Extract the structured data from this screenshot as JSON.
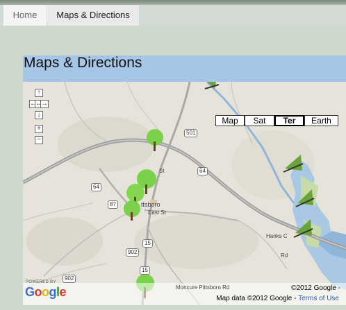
{
  "nav": {
    "home_label": "Home",
    "maps_label": "Maps & Directions"
  },
  "page": {
    "title": "Maps & Directions"
  },
  "map": {
    "controls": {
      "pan_up": "↑",
      "pan_left": "←",
      "pan_center": "↔",
      "pan_right": "→",
      "pan_down": "↓",
      "zoom_in": "+",
      "zoom_out": "−"
    },
    "map_types": [
      {
        "label": "Map",
        "active": false
      },
      {
        "label": "Sat",
        "active": false
      },
      {
        "label": "Ter",
        "active": true
      },
      {
        "label": "Earth",
        "active": false
      }
    ],
    "road_shields": [
      "501",
      "64",
      "64",
      "87",
      "64",
      "902",
      "15",
      "15",
      "902"
    ],
    "road_labels": {
      "east_st": "East St",
      "town": "ttsboro",
      "st": "St",
      "hanks": "Hanks C",
      "rd": "Rd",
      "moncure": "Moncure Pittsboro Rd"
    },
    "powered_by": "POWERED BY",
    "google_logo": [
      "G",
      "o",
      "o",
      "g",
      "l",
      "e"
    ],
    "copyright": "©2012 Google -",
    "map_data": "Map data ©2012 Google -",
    "terms_link": "Terms of Use",
    "colors": {
      "water": "#8fb5d8",
      "highway": "#8a8a8a",
      "tree_marker": "#7bd14a",
      "kayak_marker": "#6ba43a"
    }
  }
}
